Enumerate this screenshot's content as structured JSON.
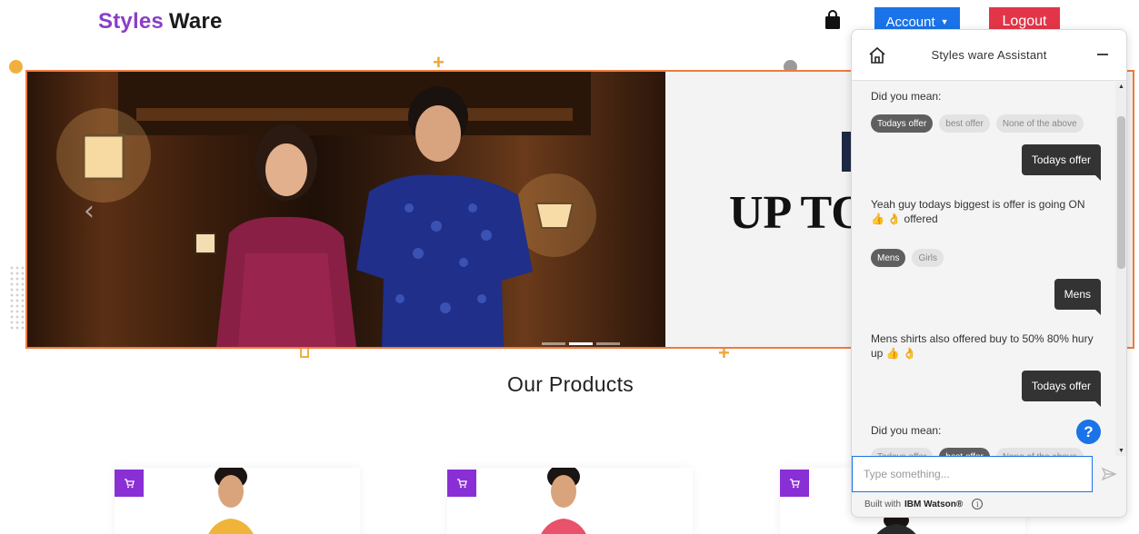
{
  "header": {
    "brand_part1": "Styles",
    "brand_part2": "Ware",
    "account_label": "Account",
    "logout_label": "Logout",
    "bag_icon": "shopping-bag-icon"
  },
  "hero": {
    "headline": "UP TO",
    "prev_icon": "chevron-left-icon",
    "slide_count": 3,
    "active_slide": 2
  },
  "products": {
    "title": "Our Products",
    "cart_icon": "cart-icon"
  },
  "chat": {
    "title": "Styles ware Assistant",
    "home_icon": "home-icon",
    "minimize_icon": "minimize-icon",
    "messages": {
      "m1_text": "Did you mean:",
      "m1_chips": [
        "Todays offer",
        "best offer",
        "None of the above"
      ],
      "u1": "Todays offer",
      "m2_text": "Yeah guy todays biggest is offer is going ON 👍 👌 offered",
      "m2_chips": [
        "Mens",
        "Girls"
      ],
      "u2": "Mens",
      "m3_text": "Mens shirts also offered buy to 50% 80% hury up 👍 👌",
      "u3": "Todays offer",
      "m4_text": "Did you mean:",
      "m4_chips": [
        "Todays offer",
        "best offer",
        "None of the above"
      ]
    },
    "help_label": "?",
    "input_placeholder": "Type something...",
    "footer_prefix": "Built with",
    "footer_brand": "IBM Watson®",
    "info_label": "i"
  },
  "colors": {
    "brand_purple": "#8a3fc8",
    "account_blue": "#1a73e8",
    "logout_red": "#e23648",
    "hero_border": "#f07c3a",
    "cart_purple": "#8a2fd6"
  }
}
